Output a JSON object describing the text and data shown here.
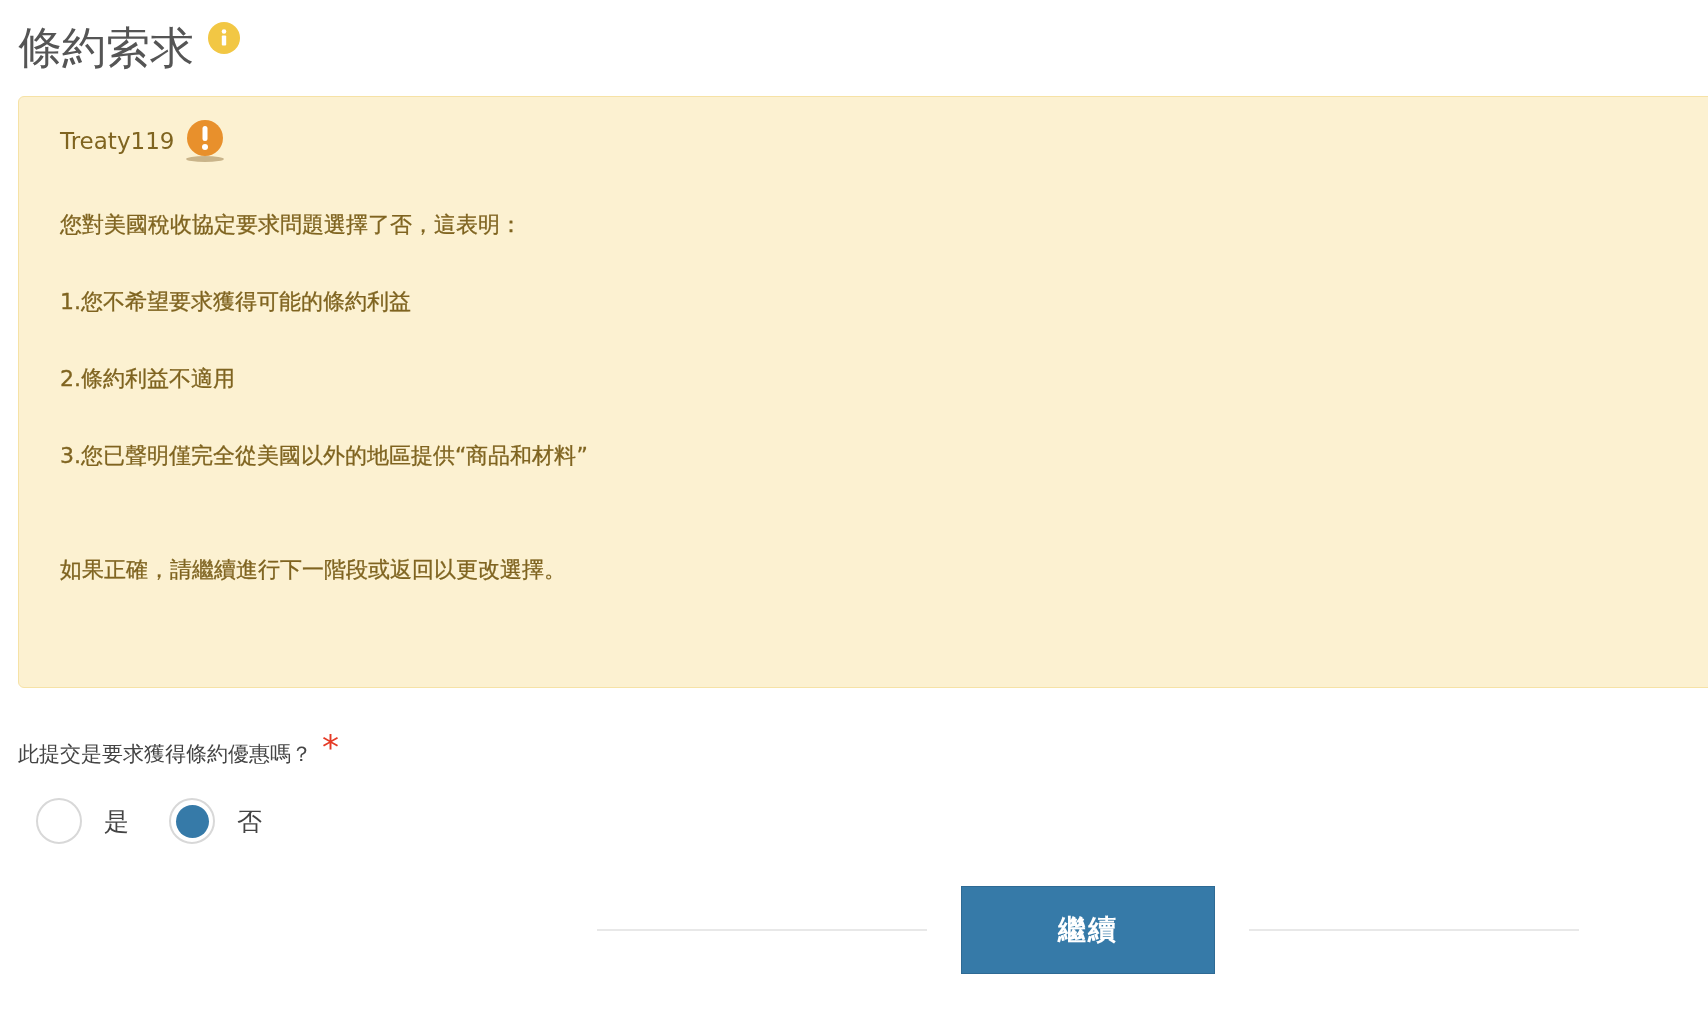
{
  "heading": {
    "title": "條約索求"
  },
  "alert": {
    "title": "Treaty119",
    "paragraphs": [
      "您對美國稅收協定要求問題選擇了否，這表明：",
      "1.您不希望要求獲得可能的條約利益",
      "2.條約利益不適用",
      "3.您已聲明僅完全從美國以外的地區提供“商品和材料”",
      "如果正確，請繼續進行下一階段或返回以更改選擇。"
    ]
  },
  "question": {
    "label": "此提交是要求獲得條約優惠嗎？",
    "required_mark": "*",
    "options": [
      {
        "label": "是",
        "selected": false
      },
      {
        "label": "否",
        "selected": true
      }
    ]
  },
  "button": {
    "label": "繼續"
  }
}
